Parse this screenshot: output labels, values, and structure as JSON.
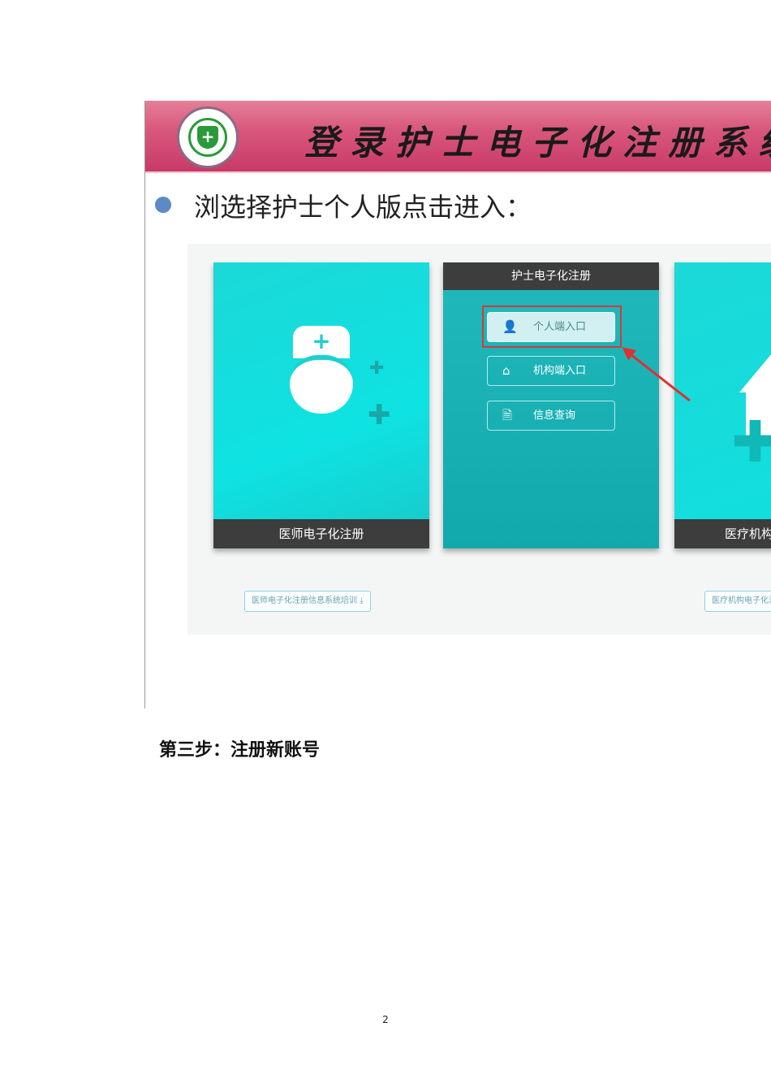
{
  "banner": {
    "title": "登录护士电子化注册系统",
    "logo_alt": "nurse registration logo"
  },
  "bullet_text": "浏选择护士个人版点击进入：",
  "screenshot": {
    "doctor_card": {
      "label": "医师电子化注册",
      "download": "医师电子化注册信息系统培训"
    },
    "nurse_card": {
      "title": "护士电子化注册",
      "options": [
        {
          "label": "个人端入口",
          "icon": "user-icon"
        },
        {
          "label": "机构端入口",
          "icon": "house-icon"
        },
        {
          "label": "信息查询",
          "icon": "document-search-icon"
        }
      ]
    },
    "institution_card": {
      "label": "医疗机构电子化注册",
      "download": "医疗机构电子化注册信息系统培训"
    }
  },
  "step_heading": "第三步：注册新账号",
  "page_number": "2",
  "colors": {
    "banner": "#d9587d",
    "teal": "#12a9ac",
    "highlight": "#d43a3a"
  }
}
